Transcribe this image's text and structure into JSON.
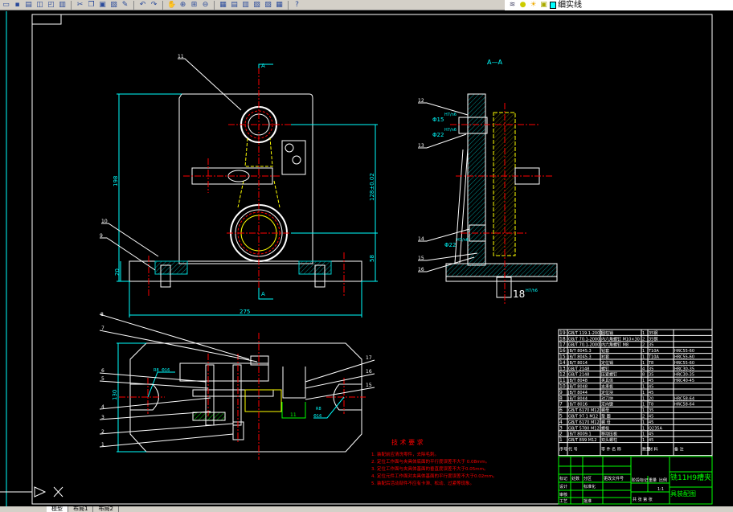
{
  "toolbar": {
    "icons": [
      "open-icon",
      "save-icon",
      "print-icon",
      "preview-icon",
      "publish-icon",
      "plot-icon",
      "cut-icon",
      "copy-icon",
      "paste-icon",
      "matchprop-icon",
      "brush-icon",
      "undo-icon",
      "redo-icon",
      "pan-icon",
      "zoom-realtime-icon",
      "zoom-window-icon",
      "zoom-previous-icon",
      "properties-icon",
      "designcenter-icon",
      "toolpalette-icon",
      "sheetset-icon",
      "markup-icon",
      "calculator-icon",
      "help-icon"
    ],
    "layer": {
      "icons": [
        "layer-manager-icon",
        "bulb-icon",
        "sun-icon",
        "lock-icon"
      ],
      "color": "#00ffff",
      "name": "细实线"
    }
  },
  "drawing": {
    "section_view_label": "A—A",
    "section_mark": "A",
    "front_dims": {
      "height": "198",
      "center_distance": "128±0.02",
      "lower": "58",
      "base": "20",
      "width": "275"
    },
    "top_dims": {
      "depth": "130",
      "hole1": "R8",
      "hole1b": "Φ16",
      "hole2": "R8",
      "hole2b": "Φ16",
      "slot": "11"
    },
    "section_dims": {
      "d1": "Φ15",
      "d1fit": "H7/n6",
      "d2": "Φ22",
      "d2fit": "H7/n6",
      "d3": "Φ22",
      "d3fit": "H7/n6",
      "key": "18",
      "keyfit": "H7/h6"
    },
    "balloons_front": [
      "11",
      "10",
      "9",
      "8"
    ],
    "balloons_top_left": [
      "7",
      "6",
      "5",
      "4",
      "3",
      "2",
      "1"
    ],
    "balloons_top_right": [
      "17",
      "16",
      "15"
    ],
    "balloons_section": [
      "12",
      "13",
      "14",
      "15",
      "16"
    ]
  },
  "tech": {
    "title": "技 术 要 求",
    "lines": [
      "1. 装配前应清洗零件，去除毛刺。",
      "2. 定位工作面与夹具体底面的平行度误差不大于 0.08mm。",
      "3. 定位工作面与夹具体基面的垂直度误差不大于0.05mm。",
      "4. 定位元件工作面对夹具体基面的平行度误差不大于0.02mm。",
      "5. 装配后活动部件不应有卡滞、松动、过紧等现象。"
    ]
  },
  "bom": {
    "header": {
      "no": "序号",
      "code": "代 号",
      "name": "零 件 名 称",
      "qty": "数量",
      "material": "材 料",
      "note": "备 注"
    },
    "rows": [
      {
        "no": "19",
        "code": "GB/T 119.1-2000",
        "name": "圆柱销",
        "qty": "1",
        "material": "35钢",
        "note": ""
      },
      {
        "no": "18",
        "code": "GB/T 70.1-2000",
        "name": "内六角螺钉 M10×30",
        "qty": "2",
        "material": "35钢",
        "note": ""
      },
      {
        "no": "17",
        "code": "GB/T 70.1-2000",
        "name": "内六角螺钉 M8",
        "qty": "2",
        "material": "35",
        "note": ""
      },
      {
        "no": "16",
        "code": "JB/T 8045.3",
        "name": "钻套",
        "qty": "1",
        "material": "T10A",
        "note": "HRC55-60"
      },
      {
        "no": "15",
        "code": "JB/T 8045.3",
        "name": "衬套",
        "qty": "1",
        "material": "T10A",
        "note": "HRC55-60"
      },
      {
        "no": "14",
        "code": "JB/T 8014",
        "name": "定位销",
        "qty": "1",
        "material": "T8",
        "note": "HRC55-60"
      },
      {
        "no": "13",
        "code": "GB/T 2148",
        "name": "螺钉",
        "qty": "4",
        "material": "35",
        "note": "HRC30-35"
      },
      {
        "no": "12",
        "code": "GB/T 2148",
        "name": "压紧螺钉",
        "qty": "8",
        "material": "35",
        "note": "HRC30-35"
      },
      {
        "no": "11",
        "code": "JB/T 8048",
        "name": "夹具体",
        "qty": "1",
        "material": "45",
        "note": "HRC40-45"
      },
      {
        "no": "10",
        "code": "JB/T 8048",
        "name": "支承板",
        "qty": "1",
        "material": "45",
        "note": ""
      },
      {
        "no": "9",
        "code": "JB/T 8044",
        "name": "定位块",
        "qty": "1",
        "material": "45",
        "note": ""
      },
      {
        "no": "8",
        "code": "JB/T 8044",
        "name": "对刀块",
        "qty": "1",
        "material": "20",
        "note": "HRC58-64"
      },
      {
        "no": "7",
        "code": "JB/T 8016",
        "name": "定向键",
        "qty": "1",
        "material": "T8",
        "note": "HRC58-64"
      },
      {
        "no": "6",
        "code": "GB/T 6170 M12",
        "name": "螺母",
        "qty": "1",
        "material": "35",
        "note": ""
      },
      {
        "no": "5",
        "code": "GB/T 97.1 M12",
        "name": "垫 圈",
        "qty": "2",
        "material": "45",
        "note": ""
      },
      {
        "no": "4",
        "code": "GB/T 6170 M12",
        "name": "螺 母",
        "qty": "1",
        "material": "45",
        "note": ""
      },
      {
        "no": "3",
        "code": "GB/T 5780 M12",
        "name": "螺栓",
        "qty": "1",
        "material": "Q235A",
        "note": ""
      },
      {
        "no": "2",
        "code": "JB/T 8009.1",
        "name": "移动压板",
        "qty": "1",
        "material": "45",
        "note": ""
      },
      {
        "no": "1",
        "code": "GB/T 899 M12",
        "name": "双头螺柱",
        "qty": "1",
        "material": "45",
        "note": ""
      }
    ]
  },
  "title_block": {
    "title_line1": "铣11H9槽夹",
    "title_line2": "具装配图",
    "scale": "1:1",
    "labels": [
      "标记",
      "处数",
      "分区",
      "更改文件号",
      "签名",
      "年月日",
      "设计",
      "标准化",
      "审核",
      "工艺",
      "批准",
      "阶段标记",
      "重量",
      "比例",
      "共 张 第 张"
    ]
  },
  "status": {
    "tabs": [
      "模型",
      "布局1",
      "布局2"
    ]
  },
  "colors": {
    "background": "#000000",
    "outline": "#ffffff",
    "dimension": "#00ffff",
    "centerline": "#ff0000",
    "hidden": "#ffff00",
    "titleblock": "#00ff00",
    "tech_text": "#ff0000"
  }
}
